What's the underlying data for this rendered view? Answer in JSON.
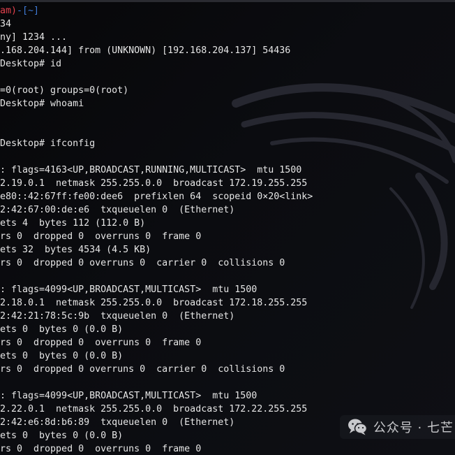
{
  "terminal": {
    "prompt_head": {
      "user": "am)",
      "dash": "-",
      "dir": "[~]"
    },
    "lines": [
      "34",
      "ny] 1234 ...",
      ".168.204.144] from (UNKNOWN) [192.168.204.137] 54436",
      "Desktop# id",
      "",
      "=0(root) groups=0(root)",
      "Desktop# whoami",
      "",
      "",
      "Desktop# ifconfig",
      "",
      ": flags=4163<UP,BROADCAST,RUNNING,MULTICAST>  mtu 1500",
      "2.19.0.1  netmask 255.255.0.0  broadcast 172.19.255.255",
      "e80::42:67ff:fe00:dee6  prefixlen 64  scopeid 0×20<link>",
      "2:42:67:00:de:e6  txqueuelen 0  (Ethernet)",
      "ets 4  bytes 112 (112.0 B)",
      "rs 0  dropped 0  overruns 0  frame 0",
      "ets 32  bytes 4534 (4.5 KB)",
      "rs 0  dropped 0 overruns 0  carrier 0  collisions 0",
      "",
      ": flags=4099<UP,BROADCAST,MULTICAST>  mtu 1500",
      "2.18.0.1  netmask 255.255.0.0  broadcast 172.18.255.255",
      "2:42:21:78:5c:9b  txqueuelen 0  (Ethernet)",
      "ets 0  bytes 0 (0.0 B)",
      "rs 0  dropped 0  overruns 0  frame 0",
      "ets 0  bytes 0 (0.0 B)",
      "rs 0  dropped 0 overruns 0  carrier 0  collisions 0",
      "",
      ": flags=4099<UP,BROADCAST,MULTICAST>  mtu 1500",
      "2.22.0.1  netmask 255.255.0.0  broadcast 172.22.255.255",
      "2:42:e6:8d:b6:89  txqueuelen 0  (Ethernet)",
      "ets 0  bytes 0 (0.0 B)",
      "rs 0  dropped 0  overruns 0  frame 0"
    ]
  },
  "watermark": {
    "icon": "wechat-icon",
    "text": "公众号 · 七芒"
  },
  "colors": {
    "background": "#0b0c10",
    "text": "#e6e6e6",
    "prompt_user": "#e3414d",
    "prompt_bracket": "#3f7ad6"
  }
}
